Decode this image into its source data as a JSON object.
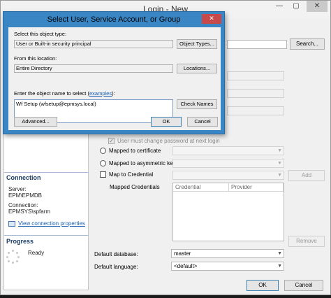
{
  "main_window": {
    "title": "Login - New",
    "min_label": "—",
    "max_label": "▢",
    "close_label": "✕",
    "search_button": "Search...",
    "user_must_change": "User must change password at next login",
    "mapped_to_certificate": "Mapped to certificate",
    "mapped_to_asymmetric_key": "Mapped to asymmetric key",
    "map_to_credential": "Map to Credential",
    "add_button": "Add",
    "mapped_credentials_label": "Mapped Credentials",
    "grid_columns": [
      "Credential",
      "Provider"
    ],
    "remove_button": "Remove",
    "default_database_label": "Default database:",
    "default_database_value": "master",
    "default_language_label": "Default language:",
    "default_language_value": "<default>",
    "ok_button": "OK",
    "cancel_button": "Cancel"
  },
  "sidebar": {
    "connection_header": "Connection",
    "server_label": "Server:",
    "server_value": "EPM\\EPMDB",
    "connection_label": "Connection:",
    "connection_value": "EPMSYS\\spfarm",
    "view_props_link": "View connection properties",
    "progress_header": "Progress",
    "progress_status": "Ready"
  },
  "dialog": {
    "title": "Select User, Service Account, or Group",
    "close_label": "✕",
    "object_type_label": "Select this object type:",
    "object_type_value": "User or Built-in security principal",
    "object_types_button": "Object Types...",
    "location_label": "From this location:",
    "location_value": "Entire Directory",
    "locations_button": "Locations...",
    "enter_name_prefix": "Enter the object name to select (",
    "examples_link": "examples",
    "enter_name_suffix": "):",
    "object_name_value": "Wf Setup (wfsetup@epmsys.local)",
    "check_names_button": "Check Names",
    "advanced_button": "Advanced...",
    "ok_button": "OK",
    "cancel_button": "Cancel"
  }
}
